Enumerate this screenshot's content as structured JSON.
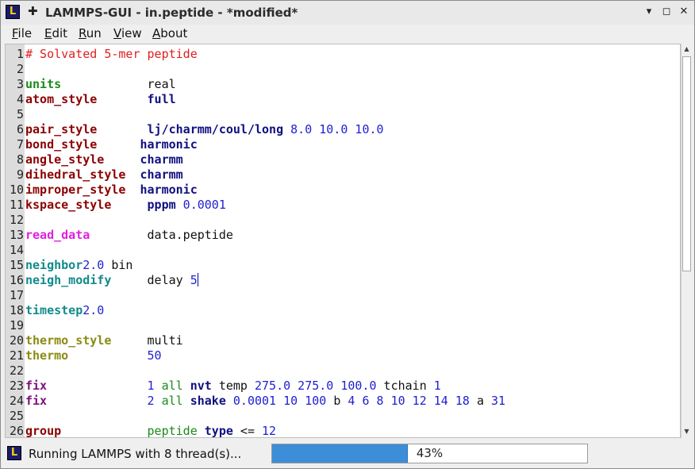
{
  "window": {
    "app_icon": "L",
    "pin_icon": "✚",
    "title": "LAMMPS-GUI - in.peptide - *modified*",
    "minimize": "▾",
    "maximize": "▴",
    "restore": "◻",
    "close": "✕"
  },
  "menu": {
    "items": [
      {
        "underline": "F",
        "rest": "ile"
      },
      {
        "underline": "E",
        "rest": "dit"
      },
      {
        "underline": "R",
        "rest": "un"
      },
      {
        "underline": "V",
        "rest": "iew"
      },
      {
        "underline": "A",
        "rest": "bout"
      }
    ]
  },
  "editor": {
    "lines": [
      {
        "n": "1",
        "t": [
          {
            "s": "# Solvated 5-mer peptide",
            "c": "comment"
          }
        ]
      },
      {
        "n": "2",
        "t": []
      },
      {
        "n": "3",
        "t": [
          {
            "s": "units",
            "c": "kw-green"
          },
          {
            "s": "            real",
            "c": "plain"
          }
        ]
      },
      {
        "n": "4",
        "t": [
          {
            "s": "atom_style",
            "c": "kw-red"
          },
          {
            "s": "       ",
            "c": "plain"
          },
          {
            "s": "full",
            "c": "kw-navy"
          }
        ]
      },
      {
        "n": "5",
        "t": []
      },
      {
        "n": "6",
        "t": [
          {
            "s": "pair_style",
            "c": "kw-red"
          },
          {
            "s": "       ",
            "c": "plain"
          },
          {
            "s": "lj/charmm/coul/long",
            "c": "kw-navy"
          },
          {
            "s": " 8.0 10.0 10.0",
            "c": "num"
          }
        ]
      },
      {
        "n": "7",
        "t": [
          {
            "s": "bond_style",
            "c": "kw-red"
          },
          {
            "s": "      ",
            "c": "plain"
          },
          {
            "s": "harmonic",
            "c": "kw-navy"
          }
        ]
      },
      {
        "n": "8",
        "t": [
          {
            "s": "angle_style",
            "c": "kw-red"
          },
          {
            "s": "     ",
            "c": "plain"
          },
          {
            "s": "charmm",
            "c": "kw-navy"
          }
        ]
      },
      {
        "n": "9",
        "t": [
          {
            "s": "dihedral_style",
            "c": "kw-red"
          },
          {
            "s": "  ",
            "c": "plain"
          },
          {
            "s": "charmm",
            "c": "kw-navy"
          }
        ]
      },
      {
        "n": "10",
        "t": [
          {
            "s": "improper_style",
            "c": "kw-red"
          },
          {
            "s": "  ",
            "c": "plain"
          },
          {
            "s": "harmonic",
            "c": "kw-navy"
          }
        ]
      },
      {
        "n": "11",
        "t": [
          {
            "s": "kspace_style",
            "c": "kw-red"
          },
          {
            "s": "     ",
            "c": "plain"
          },
          {
            "s": "pppm",
            "c": "kw-navy"
          },
          {
            "s": " 0.0001",
            "c": "num"
          }
        ]
      },
      {
        "n": "12",
        "t": []
      },
      {
        "n": "13",
        "t": [
          {
            "s": "read_data",
            "c": "kw-mag"
          },
          {
            "s": "        data.peptide",
            "c": "plain"
          }
        ]
      },
      {
        "n": "14",
        "t": []
      },
      {
        "n": "15",
        "t": [
          {
            "s": "neighbor",
            "c": "kw-teal"
          },
          {
            "s": "2.0",
            "c": "num"
          },
          {
            "s": " bin",
            "c": "plain"
          }
        ]
      },
      {
        "n": "16",
        "t": [
          {
            "s": "neigh_modify",
            "c": "kw-teal"
          },
          {
            "s": "     delay ",
            "c": "plain"
          },
          {
            "s": "5",
            "c": "num"
          },
          {
            "s": "",
            "c": "cursor"
          }
        ]
      },
      {
        "n": "17",
        "t": []
      },
      {
        "n": "18",
        "t": [
          {
            "s": "timestep",
            "c": "kw-teal"
          },
          {
            "s": "2.0",
            "c": "num"
          }
        ]
      },
      {
        "n": "19",
        "t": []
      },
      {
        "n": "20",
        "t": [
          {
            "s": "thermo_style",
            "c": "kw-olive"
          },
          {
            "s": "     multi",
            "c": "plain"
          }
        ]
      },
      {
        "n": "21",
        "t": [
          {
            "s": "thermo",
            "c": "kw-olive"
          },
          {
            "s": "           ",
            "c": "plain"
          },
          {
            "s": "50",
            "c": "num"
          }
        ]
      },
      {
        "n": "22",
        "t": []
      },
      {
        "n": "23",
        "t": [
          {
            "s": "fix",
            "c": "kw-purple"
          },
          {
            "s": "              ",
            "c": "plain"
          },
          {
            "s": "1",
            "c": "num"
          },
          {
            "s": " all ",
            "c": "grp"
          },
          {
            "s": "nvt",
            "c": "kw-navy"
          },
          {
            "s": " temp ",
            "c": "plain"
          },
          {
            "s": "275.0 275.0 100.0",
            "c": "num"
          },
          {
            "s": " tchain ",
            "c": "plain"
          },
          {
            "s": "1",
            "c": "num"
          }
        ]
      },
      {
        "n": "24",
        "t": [
          {
            "s": "fix",
            "c": "kw-purple"
          },
          {
            "s": "              ",
            "c": "plain"
          },
          {
            "s": "2",
            "c": "num"
          },
          {
            "s": " all ",
            "c": "grp"
          },
          {
            "s": "shake",
            "c": "kw-navy"
          },
          {
            "s": " 0.0001 10 100",
            "c": "num"
          },
          {
            "s": " b ",
            "c": "plain"
          },
          {
            "s": "4 6 8 10 12 14 18",
            "c": "num"
          },
          {
            "s": " a ",
            "c": "plain"
          },
          {
            "s": "31",
            "c": "num"
          }
        ]
      },
      {
        "n": "25",
        "t": []
      },
      {
        "n": "26",
        "t": [
          {
            "s": "group",
            "c": "kw-red"
          },
          {
            "s": "            ",
            "c": "plain"
          },
          {
            "s": "peptide",
            "c": "grp"
          },
          {
            "s": " ",
            "c": "plain"
          },
          {
            "s": "type",
            "c": "kw-navy"
          },
          {
            "s": " <= ",
            "c": "plain"
          },
          {
            "s": "12",
            "c": "num"
          }
        ]
      }
    ]
  },
  "scrollbar": {
    "up_icon": "▲",
    "down_icon": "▼"
  },
  "status": {
    "icon": "L",
    "text": "Running LAMMPS with 8 thread(s)...",
    "progress_label": "43%",
    "progress_fraction": 0.43
  }
}
